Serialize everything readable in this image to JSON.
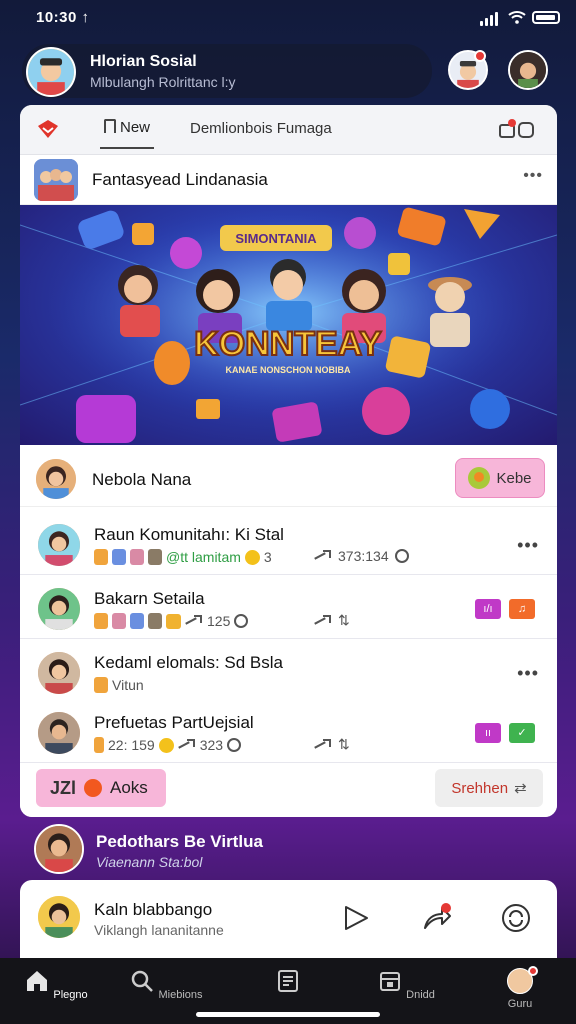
{
  "status_bar": {
    "time": "10:30 ↑"
  },
  "header": {
    "title": "Hlorian Sosial",
    "subtitle": "Mlbulangh Rolrittanc l:y"
  },
  "tabs": {
    "new_label": "New",
    "second_label": "Demlionbois Fumaga"
  },
  "post": {
    "author": "Fantasyead Lindanasia",
    "more": "•••",
    "banner_badge": "SIMONTANIA",
    "banner_title": "KONNTEAY",
    "banner_subtitle": "KANAE NONSCHON NOBIBA"
  },
  "featured": {
    "name": "Nebola Nana",
    "button_label": "Kebe"
  },
  "list": [
    {
      "title": "Raun Komunitahı: Ki Stal",
      "meta_text": "@tt lamitam",
      "meta_num": "3",
      "stats": "373:134",
      "more": "•••"
    },
    {
      "title": "Bakarn Setaila",
      "meta_num": "125",
      "stats": "",
      "tags": [
        "ı/ı",
        "♫"
      ]
    },
    {
      "title": "Kedaml elomals: Sd Bsla",
      "meta_text": "Vitun",
      "more": "•••"
    },
    {
      "title": "Prefuetas PartUejsial",
      "meta_num": "22: 159",
      "meta_num2": "323",
      "tags": [
        "ıı",
        "✓"
      ]
    }
  ],
  "actions": {
    "aoks_label": "Aoks",
    "aoks_prefix": "JZl",
    "search_label": "Srehhen",
    "search_arrows": "⇄"
  },
  "promo": {
    "title": "Pedothars Be Virtlua",
    "subtitle": "Viaenann Sta:bol"
  },
  "now_playing": {
    "title": "Kaln blabbango",
    "subtitle": "Viklangh lananitanne"
  },
  "nav": [
    {
      "label": "Plegno"
    },
    {
      "label": "Miebions"
    },
    {
      "label": ""
    },
    {
      "label": "Dnidd"
    },
    {
      "label": "Guru"
    }
  ],
  "colors": {
    "accent_pink": "#f7b6d9",
    "accent_red": "#e53935",
    "nav_bg": "#141418"
  }
}
